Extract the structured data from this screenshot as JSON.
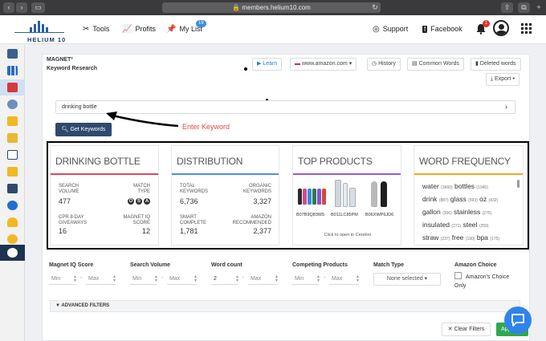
{
  "browser": {
    "url": "members.helium10.com"
  },
  "app": {
    "logo_text": "HELIUM 10"
  },
  "header": {
    "nav": [
      {
        "label": "Tools",
        "icon": "tools-icon"
      },
      {
        "label": "Profits",
        "icon": "chart-line-icon"
      },
      {
        "label": "My List",
        "icon": "pin-icon",
        "badge": "19"
      }
    ],
    "support_label": "Support",
    "facebook_label": "Facebook",
    "notification_count": "1"
  },
  "page": {
    "title": "MAGNET²",
    "subtitle": "Keyword Research",
    "toolbar": {
      "learn": "Learn",
      "marketplace": "www.amazon.com",
      "history": "History",
      "common_words": "Common Words",
      "deleted_words": "Deleted words",
      "export": "Export"
    },
    "search": {
      "value": "drinking bottle"
    },
    "get_keywords_label": "Get Keywords",
    "annotation": "Enter Keyword"
  },
  "cards": {
    "keyword": {
      "title": "DRINKING BOTTLE",
      "search_volume_label": "SEARCH VOLUME",
      "search_volume": "477",
      "match_type_label": "MATCH TYPE",
      "match_types": [
        "O",
        "S",
        "A"
      ],
      "giveaways_label": "CPR 8-DAY GIVEAWAYS",
      "giveaways": "16",
      "iq_label": "MAGNET IQ SCORE",
      "iq": "12"
    },
    "distribution": {
      "title": "DISTRIBUTION",
      "total_label": "TOTAL KEYWORDS",
      "total": "6,736",
      "organic_label": "ORGANIC KEYWORDS",
      "organic": "3,327",
      "smart_label": "SMART COMPLETE",
      "smart": "1,781",
      "amazon_label": "AMAZON RECOMMENDED",
      "amazon": "2,377"
    },
    "products": {
      "title": "TOP PRODUCTS",
      "asins": [
        "B07B9Q83W5",
        "B011LC85PM",
        "B06XWP6JD6"
      ],
      "footer": "Click to open in Cerebro"
    },
    "words": {
      "title": "WORD FREQUENCY",
      "rows": [
        [
          {
            "w": "water",
            "c": "(3660)"
          },
          {
            "w": "bottles",
            "c": "(1045)"
          }
        ],
        [
          {
            "w": "drink",
            "c": "(887)"
          },
          {
            "w": "glass",
            "c": "(593)"
          },
          {
            "w": "oz",
            "c": "(432)"
          }
        ],
        [
          {
            "w": "gallon",
            "c": "(306)"
          },
          {
            "w": "stainless",
            "c": "(275)"
          }
        ],
        [
          {
            "w": "insulated",
            "c": "(271)"
          },
          {
            "w": "steel",
            "c": "(259)"
          }
        ],
        [
          {
            "w": "straw",
            "c": "(237)"
          },
          {
            "w": "free",
            "c": "(190)"
          },
          {
            "w": "bpa",
            "c": "(175)"
          }
        ]
      ]
    }
  },
  "filters": {
    "iq": {
      "label": "Magnet IQ Score",
      "min": "Min",
      "max": "Max"
    },
    "volume": {
      "label": "Search Volume",
      "min": "Min",
      "max": "Max"
    },
    "words": {
      "label": "Word count",
      "min": "2",
      "max": "Max"
    },
    "competing": {
      "label": "Competing Products",
      "min": "Min",
      "max": "Max"
    },
    "match": {
      "label": "Match Type",
      "value": "None selected"
    },
    "choice": {
      "label": "Amazon Choice",
      "checkbox_label": "Amazon's Choice Only"
    },
    "advanced": "ADVANCED FILTERS",
    "clear": "Clear Filters",
    "apply": "Apply"
  },
  "colors": {
    "keyword_line": "#e0435e",
    "distribution_line": "#4a90e2",
    "products_line": "#8f5bd6",
    "words_line": "#f5a623",
    "annotation": "#e04848"
  }
}
